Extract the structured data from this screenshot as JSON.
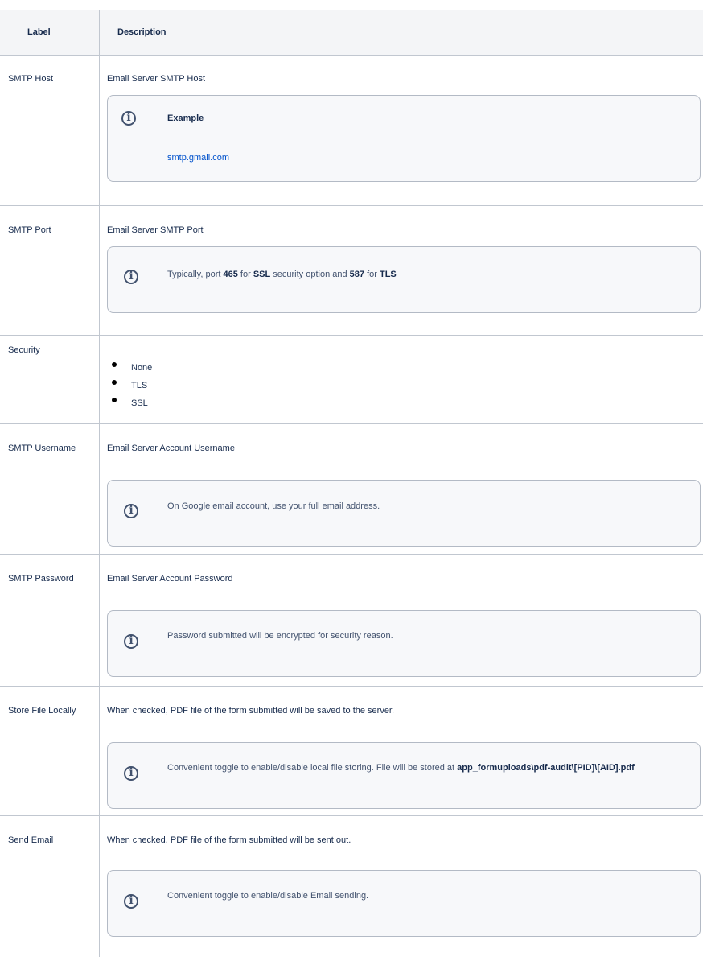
{
  "header": {
    "label": "Label",
    "description": "Description"
  },
  "rows": [
    {
      "label": "SMTP Host",
      "description": "Email Server SMTP Host",
      "panel": {
        "title": "Example",
        "link": "smtp.gmail.com"
      }
    },
    {
      "label": "SMTP Port",
      "description": "Email Server SMTP Port",
      "panel": {
        "text_parts": [
          "Typically, port ",
          "465",
          " for ",
          "SSL",
          " security option and ",
          "587",
          " for ",
          "TLS"
        ]
      }
    },
    {
      "label": "Security",
      "options": [
        "None",
        "TLS",
        "SSL"
      ]
    },
    {
      "label": "SMTP Username",
      "description": "Email Server Account Username",
      "panel": {
        "text": "On Google email account, use your full email address."
      }
    },
    {
      "label": "SMTP Password",
      "description": "Email Server Account Password",
      "panel": {
        "text": "Password submitted will be encrypted for security reason."
      }
    },
    {
      "label": "Store File Locally",
      "description": "When checked, PDF file of the form submitted will be saved to the server.",
      "panel": {
        "text": "Convenient toggle to enable/disable local file storing. File will be stored at ",
        "path": "app_formuploads\\pdf-audit\\[PID]\\[AID].pdf"
      }
    },
    {
      "label": "Send Email",
      "description": "When checked, PDF file of the form submitted will be sent out.",
      "panel": {
        "text": "Convenient toggle to enable/disable Email sending."
      }
    }
  ],
  "icons": {
    "info": "info-circle-icon"
  },
  "colors": {
    "link": "#0052cc",
    "border": "#c1c7d0",
    "panel_bg": "#f7f8fa"
  }
}
